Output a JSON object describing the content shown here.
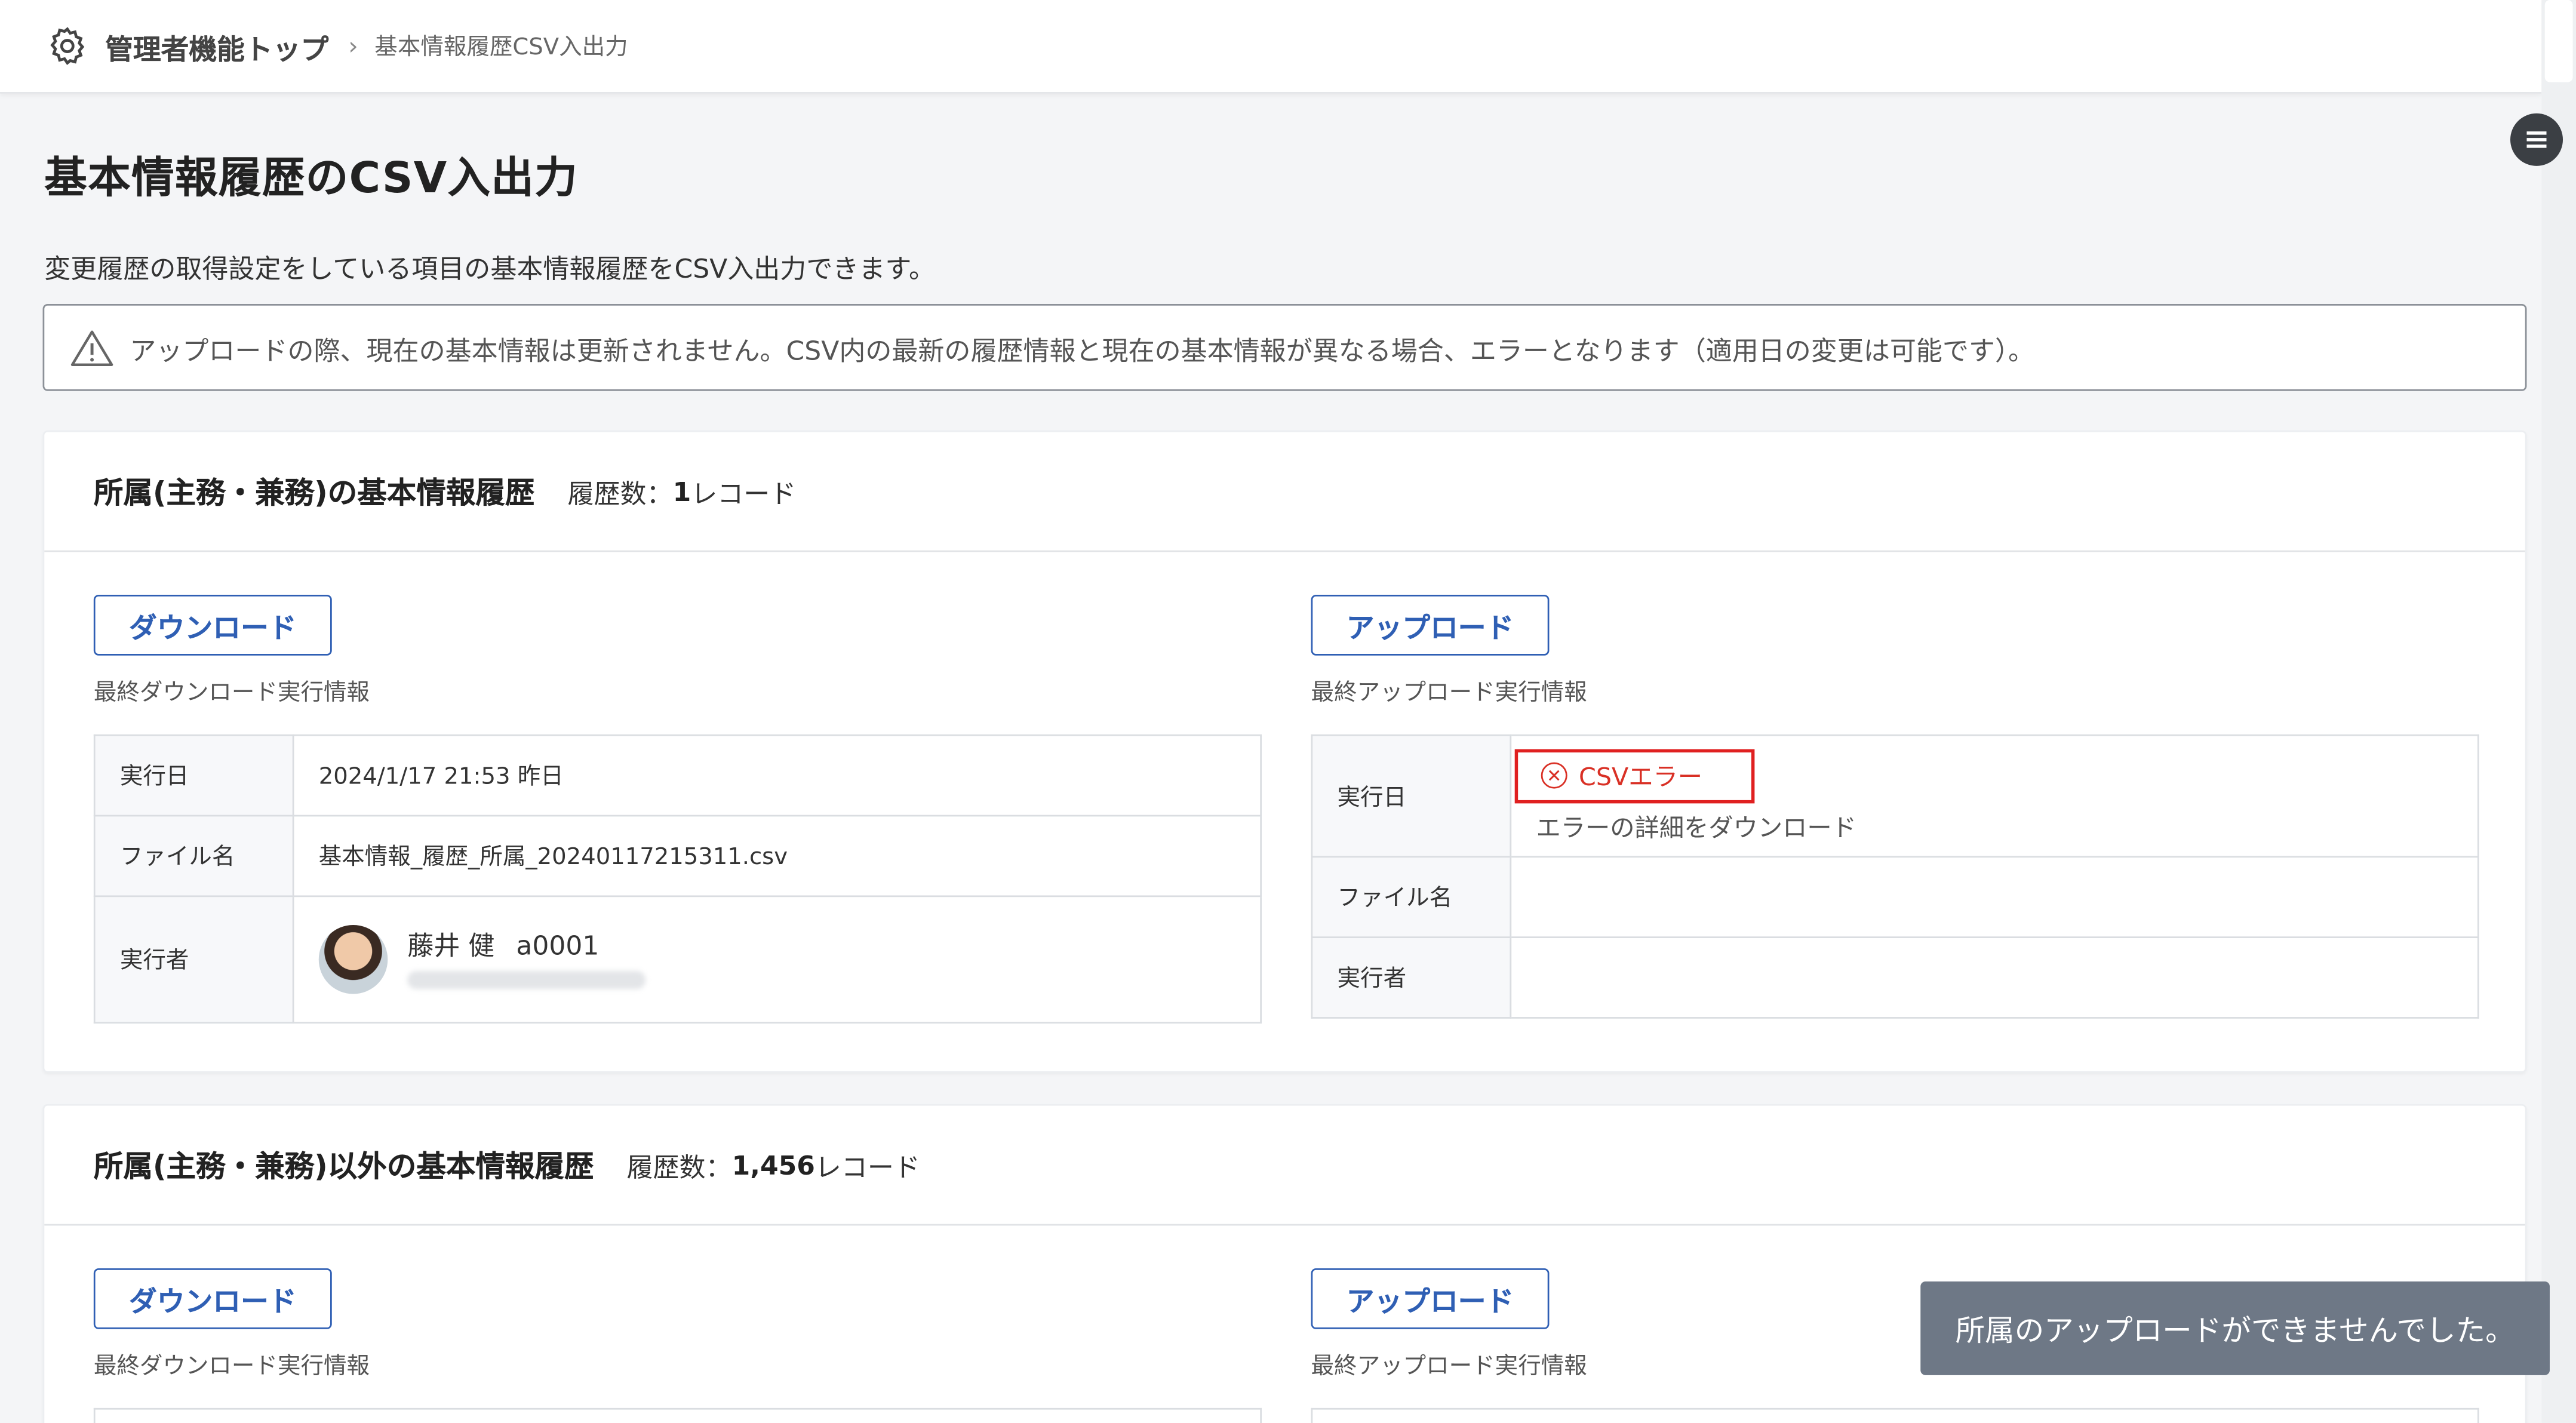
{
  "header": {
    "breadcrumb_home": "管理者機能トップ",
    "breadcrumb_current": "基本情報履歴CSV入出力"
  },
  "page": {
    "title": "基本情報履歴のCSV入出力",
    "description": "変更履歴の取得設定をしている項目の基本情報履歴をCSV入出力できます。",
    "notice": "アップロードの際、現在の基本情報は更新されません。CSV内の最新の履歴情報と現在の基本情報が異なる場合、エラーとなります（適用日の変更は可能です）。"
  },
  "section1": {
    "title": "所属(主務・兼務)の基本情報履歴",
    "count_label": "履歴数：",
    "count_value": "1",
    "count_unit": "レコード",
    "download_button": "ダウンロード",
    "upload_button": "アップロード",
    "download_info_label": "最終ダウンロード実行情報",
    "upload_info_label": "最終アップロード実行情報",
    "download_table": {
      "date_key": "実行日",
      "date_value": "2024/1/17 21:53 昨日",
      "file_key": "ファイル名",
      "file_value": "基本情報_履歴_所属_20240117215311.csv",
      "user_key": "実行者",
      "user_name": "藤井 健",
      "user_id": "a0001"
    },
    "upload_table": {
      "date_key": "実行日",
      "error_label": "CSVエラー",
      "error_link": "エラーの詳細をダウンロード",
      "file_key": "ファイル名",
      "user_key": "実行者"
    }
  },
  "section2": {
    "title": "所属(主務・兼務)以外の基本情報履歴",
    "count_label": "履歴数：",
    "count_value": "1,456",
    "count_unit": "レコード",
    "download_button": "ダウンロード",
    "upload_button": "アップロード",
    "download_info_label": "最終ダウンロード実行情報",
    "upload_info_label": "最終アップロード実行情報"
  },
  "toast": {
    "message": "所属のアップロードができませんでした。"
  },
  "colors": {
    "accent": "#2f5fb4",
    "error": "#d93025",
    "toast_bg": "#6e7886"
  }
}
